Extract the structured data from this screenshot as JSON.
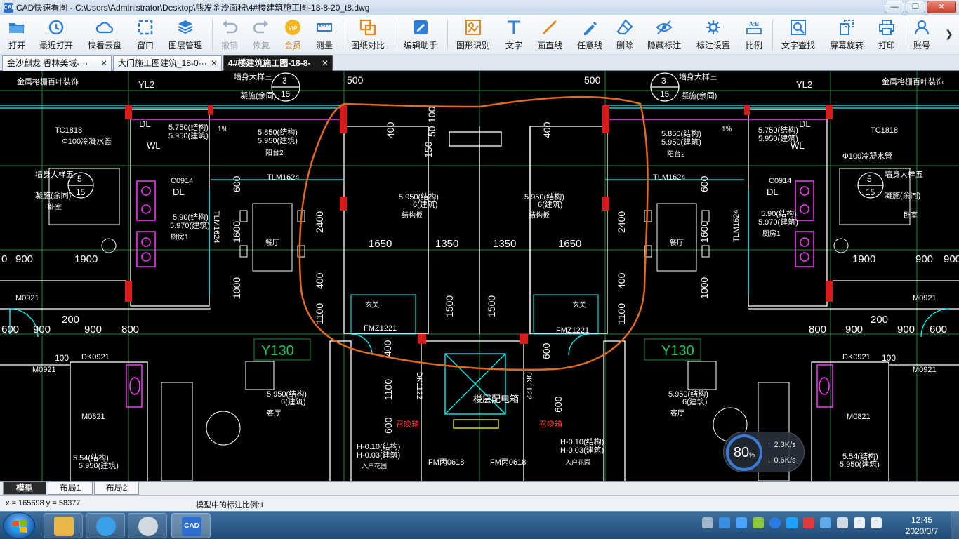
{
  "window": {
    "title": "CAD快速看图 - C:\\Users\\Administrator\\Desktop\\熊发金沙面积\\4#楼建筑施工图-18-8-20_t8.dwg",
    "app_icon_text": "CAD",
    "minimize": "—",
    "maximize": "❐",
    "close": "✕"
  },
  "toolbar": {
    "items": [
      {
        "label": "打开",
        "icon": "folder-open-icon"
      },
      {
        "label": "最近打开",
        "icon": "recent-icon"
      },
      {
        "label": "快看云盘",
        "icon": "cloud-icon"
      },
      {
        "label": "窗口",
        "icon": "window-icon"
      },
      {
        "label": "图层管理",
        "icon": "layers-icon"
      },
      {
        "label": "撤销",
        "icon": "undo-icon"
      },
      {
        "label": "恢复",
        "icon": "redo-icon"
      },
      {
        "label": "会员",
        "icon": "vip-icon"
      },
      {
        "label": "测量",
        "icon": "measure-icon"
      },
      {
        "label": "图纸对比",
        "icon": "compare-icon"
      },
      {
        "label": "编辑助手",
        "icon": "edit-assistant-icon"
      },
      {
        "label": "图形识别",
        "icon": "shape-recognize-icon"
      },
      {
        "label": "文字",
        "icon": "text-icon"
      },
      {
        "label": "画直线",
        "icon": "line-icon"
      },
      {
        "label": "任意线",
        "icon": "freehand-icon"
      },
      {
        "label": "删除",
        "icon": "eraser-icon"
      },
      {
        "label": "隐藏标注",
        "icon": "hide-annotation-icon"
      },
      {
        "label": "标注设置",
        "icon": "annotation-settings-icon"
      },
      {
        "label": "比例",
        "icon": "scale-icon"
      },
      {
        "label": "文字查找",
        "icon": "text-search-icon"
      },
      {
        "label": "屏幕旋转",
        "icon": "rotate-screen-icon"
      },
      {
        "label": "打印",
        "icon": "print-icon"
      },
      {
        "label": "账号",
        "icon": "account-icon"
      }
    ],
    "vip_badge": "VIP",
    "ab_badge": "A:B"
  },
  "tabs": [
    {
      "label": "金沙麒龙 香林美域-···",
      "close": "✕"
    },
    {
      "label": "大门施工图建筑_18-0···",
      "close": "✕"
    },
    {
      "label": "4#楼建筑施工图-18-8-",
      "close": "✕"
    }
  ],
  "drawing": {
    "dims_top": [
      "500",
      "500"
    ],
    "circle_refs": [
      {
        "top": "3",
        "bottom": "15"
      },
      {
        "top": "3",
        "bottom": "15"
      },
      {
        "top": "5",
        "bottom": "15"
      },
      {
        "top": "5",
        "bottom": "15"
      }
    ],
    "labels": {
      "louver": "金属格栅百叶装饰",
      "yl2": "YL2",
      "dl": "DL",
      "wl": "WL",
      "tc1818": "TC1818",
      "pipe": "Φ100冷凝水管",
      "wall_detail3": "墙身大样三",
      "wall_detail5": "墙身大样五",
      "same_slab": "凝施(余同)",
      "elev_5750": "5.750(结构)",
      "elev_5950": "5.950(建筑)",
      "elev_5850": "5.850(结构)",
      "elev_5950b": "5.950(建筑)",
      "elev_590": "5.90(结构)",
      "elev_5970": "5.970(建筑)",
      "elev_5950s": "5.950(结构)",
      "elev_6": "6(建筑)",
      "c0914": "C0914",
      "tlm1624": "TLM1624",
      "tlm1624v": "TLM1624",
      "dining": "餐厅",
      "kitchen": "厨房1",
      "bedroom": "卧室",
      "entry": "玄关",
      "fmz1221": "FMZ1221",
      "m0921": "M0921",
      "m0821": "M0821",
      "dk0921": "DK0921",
      "dk1122": "DK1122",
      "y130": "Y130",
      "panel": "楼层配电箱",
      "fire_hydrant": "召唤箱",
      "fm0618": "FM丙0618",
      "h010": "H-0.10(结构)",
      "h003": "H-0.03(建筑)",
      "elev_554": "5.54(结构)",
      "elev_5950c": "5.950(建筑)",
      "living": "客厅",
      "household": "入户花园",
      "balcony": "阳台2",
      "struct_slab": "结构板",
      "slope": "1%"
    },
    "dims_row1": [
      "1650",
      "1350",
      "1350",
      "1650"
    ],
    "dims_mid_left": [
      "0",
      "900",
      "1900"
    ],
    "dims_mid_right": [
      "1900",
      "900",
      "900"
    ],
    "dims_row2_left": [
      "600",
      "900",
      "900",
      "800"
    ],
    "dims_row2_right": [
      "800",
      "900",
      "900",
      "600"
    ],
    "dims_200": "200",
    "dims_100": "100",
    "vert_dims": [
      "400",
      "150",
      "50",
      "100",
      "2400",
      "400",
      "1100",
      "1500",
      "1500",
      "600",
      "1000",
      "1600",
      "1100",
      "600",
      "400"
    ]
  },
  "net_widget": {
    "percent": "80",
    "unit": "%",
    "up": "2.3K/s",
    "down": "0.6K/s"
  },
  "layout_tabs": [
    "模型",
    "布局1",
    "布局2"
  ],
  "status": {
    "coords": "x = 165698  y = 58377",
    "scale": "模型中的标注比例:1"
  },
  "clock": {
    "time": "12:45",
    "date": "2020/3/7"
  },
  "colors": {
    "cad_bg": "#000000",
    "highlight": "#e06a1e",
    "cyan": "#00ffff",
    "magenta": "#ff00ff",
    "green": "#00c853",
    "red": "#ff2020",
    "yellow": "#ffff00"
  }
}
